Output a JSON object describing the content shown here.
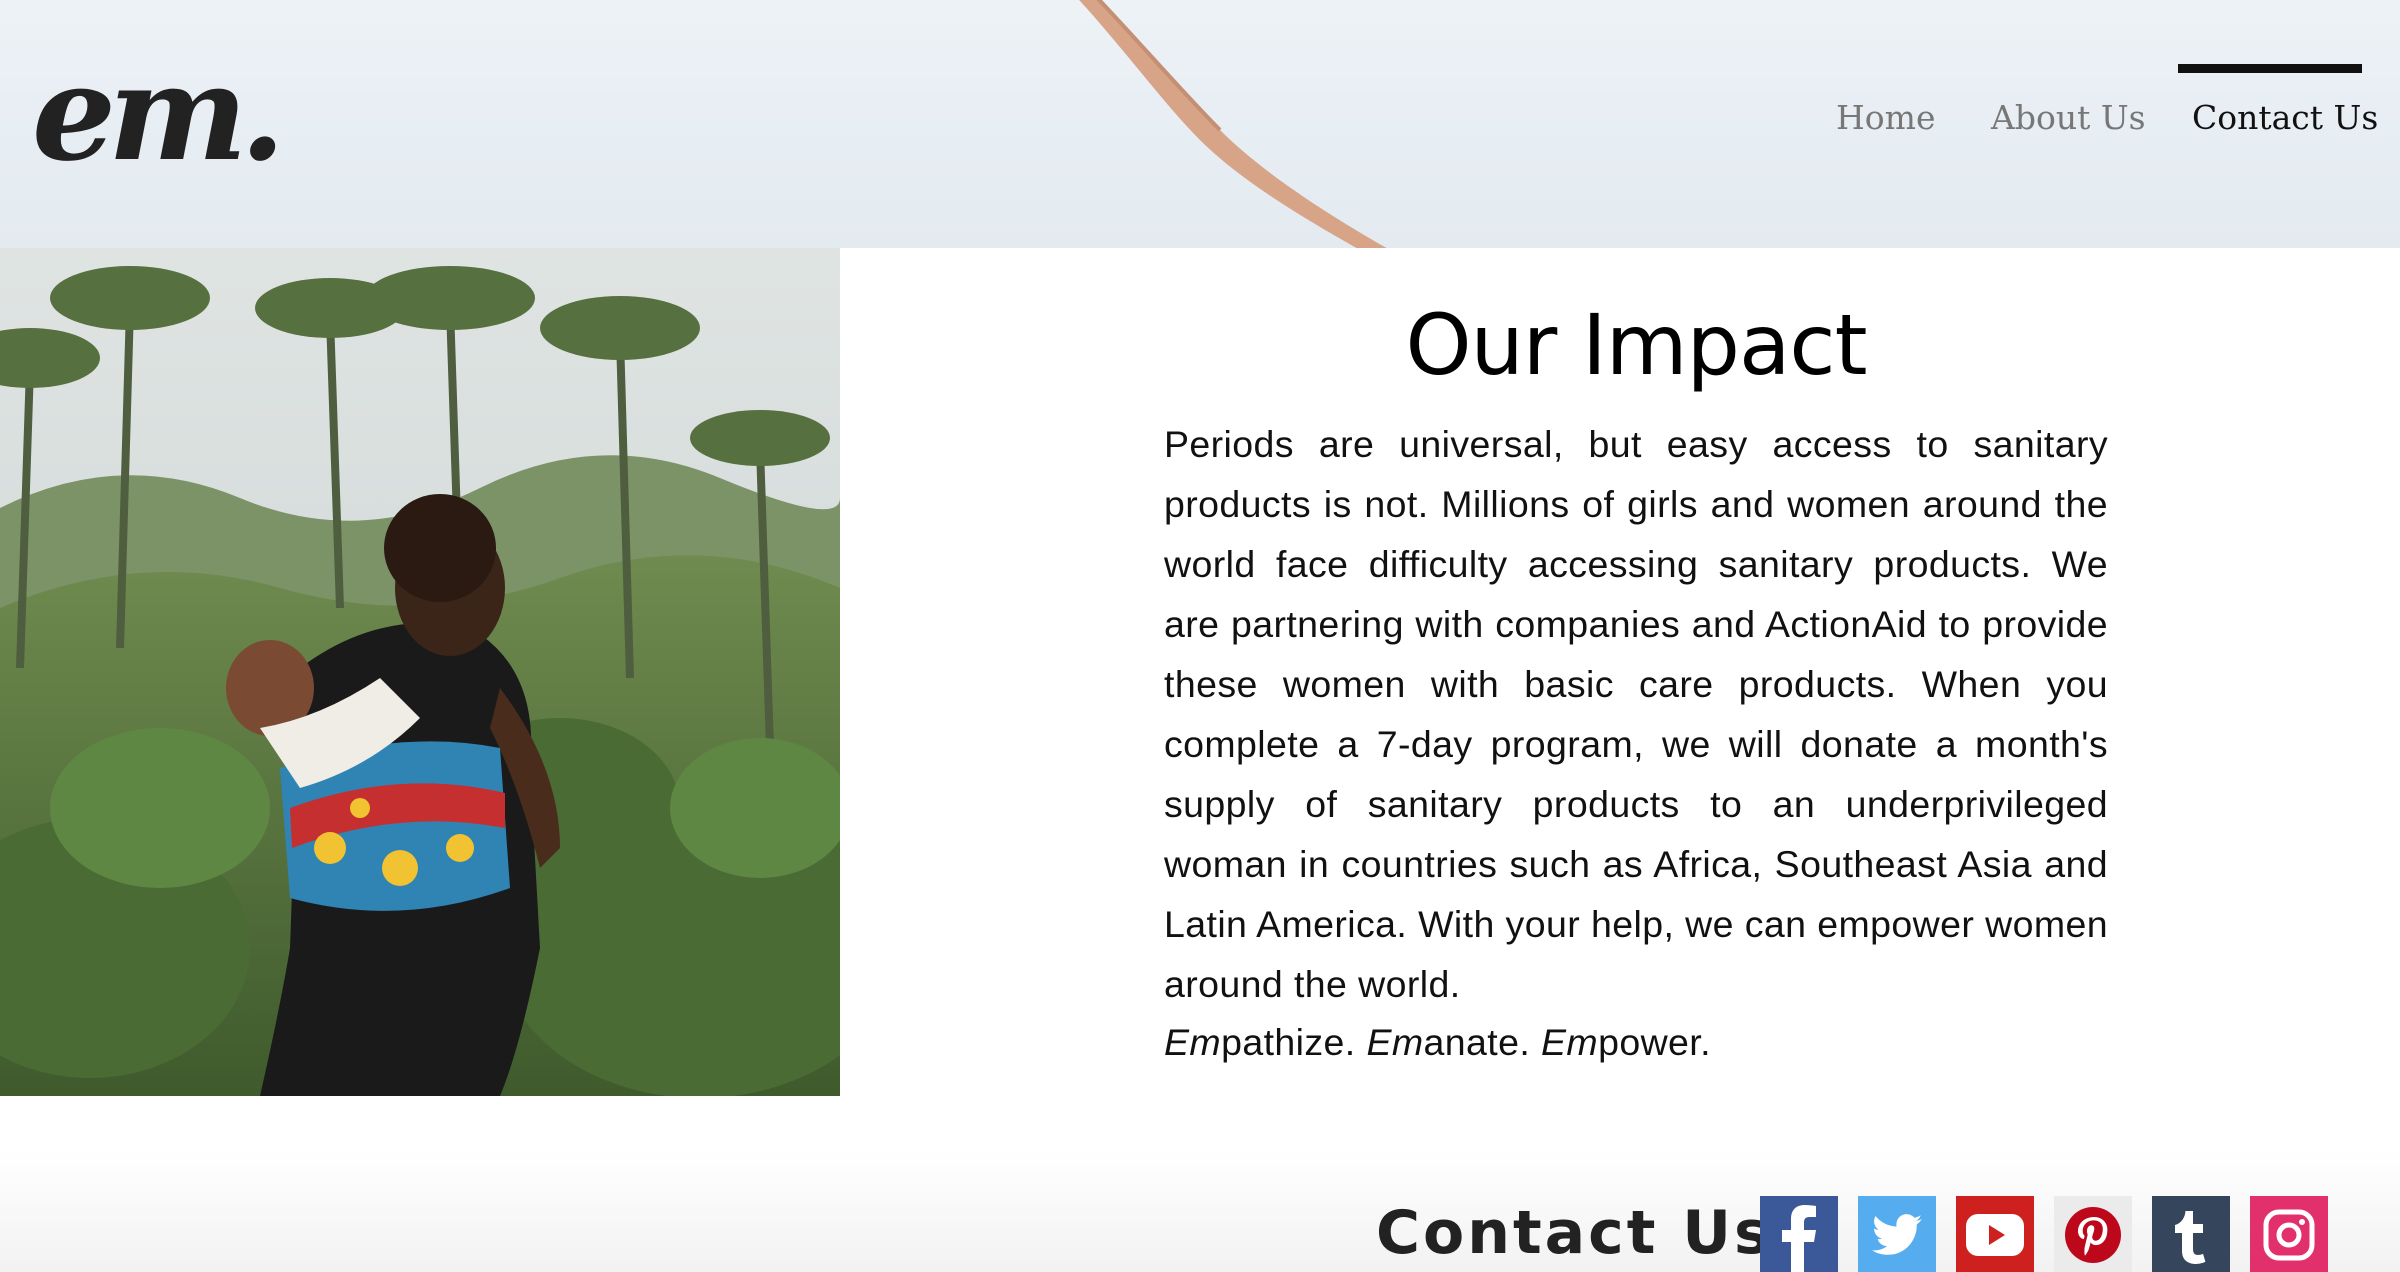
{
  "header": {
    "logo_text": "em.",
    "nav": [
      {
        "label": "Home",
        "active": false
      },
      {
        "label": "About Us",
        "active": false
      },
      {
        "label": "Contact Us",
        "active": true
      }
    ]
  },
  "impact": {
    "title": "Our Impact",
    "body": "Periods are universal, but easy access to sanitary products is not. Millions of girls and women around the world face difficulty accessing sanitary products. We are partnering with companies and ActionAid to provide these women with basic care products. When you complete a 7-day program, we will donate a month's supply of sanitary products to an underprivileged woman in countries such as Africa, Southeast Asia and Latin America. With your help, we can empower women around the world.",
    "tagline": [
      {
        "prefix": "Em",
        "rest": "pathize."
      },
      {
        "prefix": "Em",
        "rest": "anate."
      },
      {
        "prefix": "Em",
        "rest": "power."
      }
    ]
  },
  "footer": {
    "contact_label": "Contact Us:",
    "social": [
      {
        "icon": "facebook-icon",
        "color": "#3b5998"
      },
      {
        "icon": "twitter-icon",
        "color": "#55acee"
      },
      {
        "icon": "youtube-icon",
        "color": "#cd201f"
      },
      {
        "icon": "pinterest-icon",
        "color": "#bd081c"
      },
      {
        "icon": "tumblr-icon",
        "color": "#35465c"
      },
      {
        "icon": "instagram-icon",
        "color": "#e1306c"
      }
    ]
  }
}
